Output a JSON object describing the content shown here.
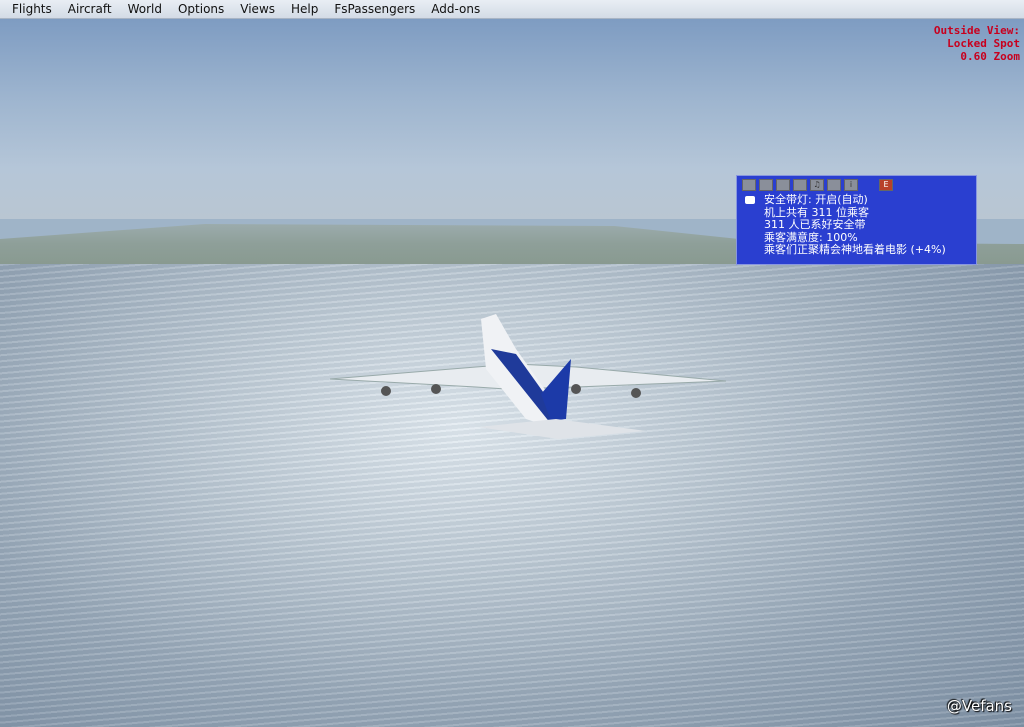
{
  "menu": [
    "Flights",
    "Aircraft",
    "World",
    "Options",
    "Views",
    "Help",
    "FsPassengers",
    "Add-ons"
  ],
  "hud": {
    "view": "Outside View:",
    "mode": "Locked Spot",
    "zoom": "0.60 Zoom"
  },
  "panel": {
    "toolbar": [
      "eye-icon",
      "folder-icon",
      "food-icon",
      "printer-icon",
      "music-icon",
      "chart-icon",
      "info-icon"
    ],
    "toolbar_e": "E",
    "lines": [
      "安全带灯: 开启(自动)",
      "机上共有 311 位乘客",
      "311 人已系好安全带",
      "乘客满意度: 100%",
      "乘客们正聚精会神地看着电影 (+4%)"
    ]
  },
  "watermark": "@Vefans",
  "colors": {
    "panel": "#2a3fd0",
    "hud": "#c8001e"
  }
}
